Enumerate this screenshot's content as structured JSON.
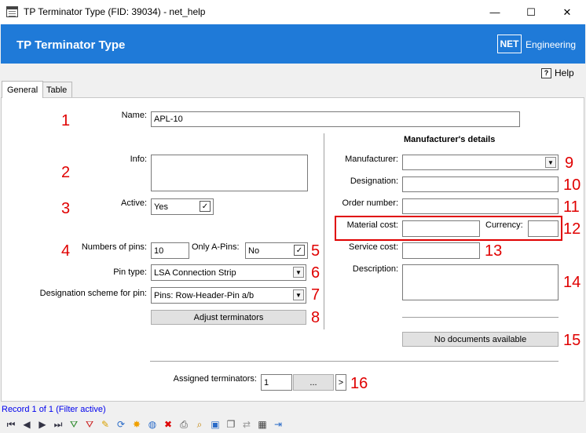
{
  "window": {
    "title": "TP Terminator Type (FID: 39034) - net_help",
    "minimize": "—",
    "maximize": "☐",
    "close": "✕"
  },
  "header": {
    "title": "TP Terminator Type",
    "logo": "NET",
    "brand": "Engineering",
    "color": "#1f7ad8"
  },
  "help": {
    "label": "Help",
    "icon": "?"
  },
  "tabs": [
    {
      "label": "General"
    },
    {
      "label": "Table"
    }
  ],
  "form": {
    "name": {
      "label": "Name:",
      "value": "APL-10"
    },
    "info": {
      "label": "Info:",
      "value": ""
    },
    "active": {
      "label": "Active:",
      "value": "Yes",
      "check": "✓"
    },
    "pins": {
      "label": "Numbers of pins:",
      "value": "10"
    },
    "only_a_pins": {
      "label": "Only A-Pins:",
      "value": "No",
      "check": "✓"
    },
    "pin_type": {
      "label": "Pin type:",
      "value": "LSA Connection Strip"
    },
    "scheme": {
      "label": "Designation scheme for pin:",
      "value": "Pins: Row-Header-Pin a/b"
    },
    "adjust_button": "Adjust terminators",
    "assigned": {
      "label": "Assigned terminators:",
      "value": "1",
      "dots": "...",
      "next": ">"
    }
  },
  "manufacturer": {
    "heading": "Manufacturer's details",
    "manufacturer": {
      "label": "Manufacturer:",
      "value": ""
    },
    "designation": {
      "label": "Designation:",
      "value": ""
    },
    "order_number": {
      "label": "Order number:",
      "value": ""
    },
    "material_cost": {
      "label": "Material cost:",
      "value": ""
    },
    "currency": {
      "label": "Currency:",
      "value": ""
    },
    "service_cost": {
      "label": "Service cost:",
      "value": ""
    },
    "description": {
      "label": "Description:",
      "value": ""
    },
    "documents_button": "No documents available"
  },
  "annotations": [
    "1",
    "2",
    "3",
    "4",
    "5",
    "6",
    "7",
    "8",
    "9",
    "10",
    "11",
    "12",
    "13",
    "14",
    "15",
    "16"
  ],
  "status": {
    "record": "Record 1 of 1 (Filter active)"
  },
  "toolbar_icons": [
    "first-record-icon",
    "previous-record-icon",
    "next-record-icon",
    "last-record-icon",
    "add-filter-icon",
    "remove-filter-icon",
    "edit-icon",
    "refresh-icon",
    "new-record-icon",
    "globe-icon",
    "delete-icon",
    "print-icon",
    "zoom-icon",
    "select-icon",
    "copy-icon",
    "move-icon",
    "table-edit-icon",
    "exit-icon"
  ]
}
